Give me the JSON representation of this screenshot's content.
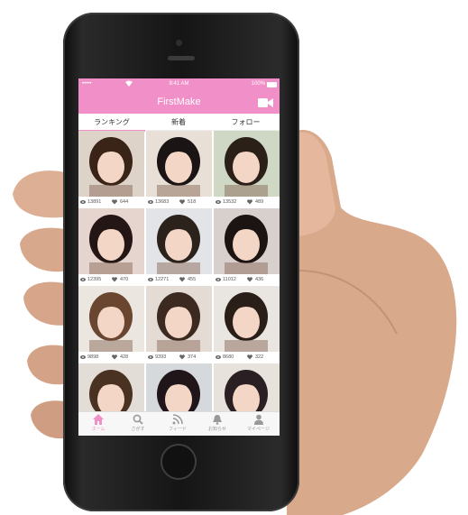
{
  "status_bar": {
    "signal": "•••••",
    "time": "9:41 AM",
    "battery": "100%"
  },
  "header": {
    "title": "FirstMake",
    "icon": "video-camera-icon",
    "color": "#f08fc8"
  },
  "tabs": [
    {
      "label": "ランキング",
      "active": true
    },
    {
      "label": "新着",
      "active": false
    },
    {
      "label": "フォロー",
      "active": false
    }
  ],
  "grid": [
    {
      "views": "13891",
      "likes": "644"
    },
    {
      "views": "13683",
      "likes": "518"
    },
    {
      "views": "13532",
      "likes": "489"
    },
    {
      "views": "12395",
      "likes": "470"
    },
    {
      "views": "12271",
      "likes": "455"
    },
    {
      "views": "11012",
      "likes": "436"
    },
    {
      "views": "9898",
      "likes": "428"
    },
    {
      "views": "9393",
      "likes": "374"
    },
    {
      "views": "8680",
      "likes": "322"
    },
    {
      "views": "",
      "likes": ""
    },
    {
      "views": "",
      "likes": ""
    },
    {
      "views": "",
      "likes": ""
    }
  ],
  "bottom_nav": [
    {
      "label": "ホーム",
      "icon": "home-icon",
      "active": true
    },
    {
      "label": "さがす",
      "icon": "search-icon",
      "active": false
    },
    {
      "label": "フィード",
      "icon": "rss-icon",
      "active": false
    },
    {
      "label": "お知らせ",
      "icon": "bell-icon",
      "active": false
    },
    {
      "label": "マイページ",
      "icon": "user-icon",
      "active": false
    }
  ]
}
